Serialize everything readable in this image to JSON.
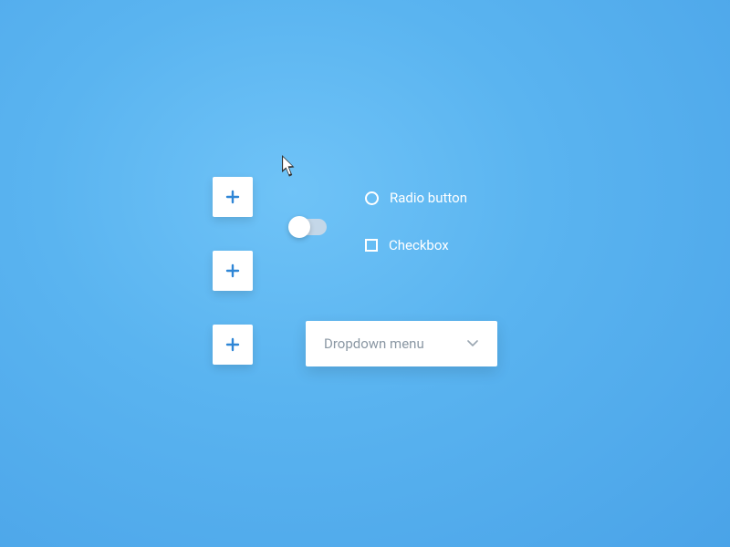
{
  "buttons": {
    "add1_icon": "plus",
    "add2_icon": "plus",
    "add3_icon": "plus"
  },
  "toggle": {
    "state": "off"
  },
  "radio": {
    "label": "Radio button"
  },
  "checkbox": {
    "label": "Checkbox"
  },
  "dropdown": {
    "label": "Dropdown menu"
  }
}
